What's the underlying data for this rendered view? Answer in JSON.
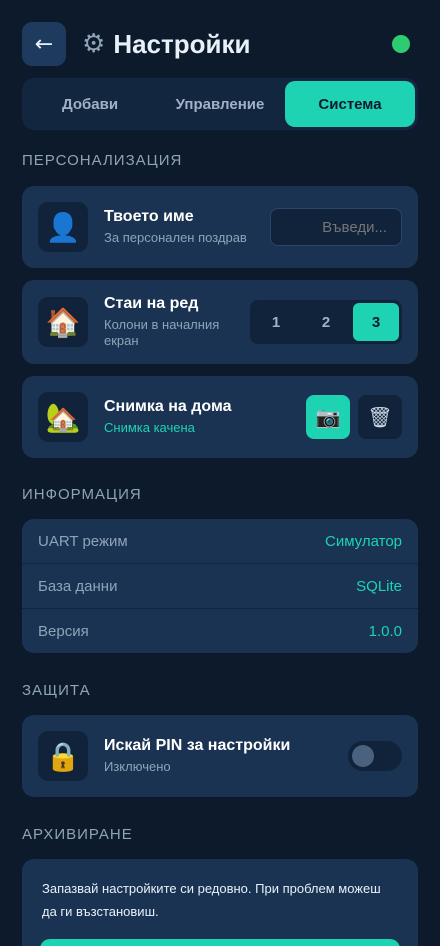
{
  "header": {
    "back_icon": "←",
    "gear_icon": "⚙",
    "title": "Настройки",
    "status_color": "#2ecc71"
  },
  "tabs": [
    {
      "label": "Добави",
      "active": false
    },
    {
      "label": "Управление",
      "active": false
    },
    {
      "label": "Система",
      "active": true
    }
  ],
  "personalization": {
    "section_title": "ПЕРСОНАЛИЗАЦИЯ",
    "name": {
      "icon": "👤",
      "title": "Твоето име",
      "subtitle": "За персонален поздрав",
      "placeholder": "Въведи..."
    },
    "rooms": {
      "icon": "🏠",
      "title": "Стаи на ред",
      "subtitle": "Колони в началния екран",
      "options": [
        "1",
        "2",
        "3"
      ],
      "selected": "3"
    },
    "photo": {
      "icon": "🏡",
      "title": "Снимка на дома",
      "subtitle": "Снимка качена",
      "camera_icon": "📷",
      "trash_icon": "🗑"
    }
  },
  "information": {
    "section_title": "ИНФОРМАЦИЯ",
    "rows": [
      {
        "label": "UART режим",
        "value": "Симулатор"
      },
      {
        "label": "База данни",
        "value": "SQLite"
      },
      {
        "label": "Версия",
        "value": "1.0.0"
      }
    ]
  },
  "security": {
    "section_title": "ЗАЩИТА",
    "pin": {
      "icon": "🔒",
      "title": "Искай PIN за настройки",
      "subtitle": "Изключено",
      "enabled": false
    }
  },
  "archive": {
    "section_title": "АРХИВИРАНЕ",
    "description": "Запазвай настройките си редовно. При проблем можеш да ги възстановиш."
  },
  "colors": {
    "accent": "#1ed3b1",
    "background": "#0c1a2b",
    "card": "#1a3352"
  }
}
